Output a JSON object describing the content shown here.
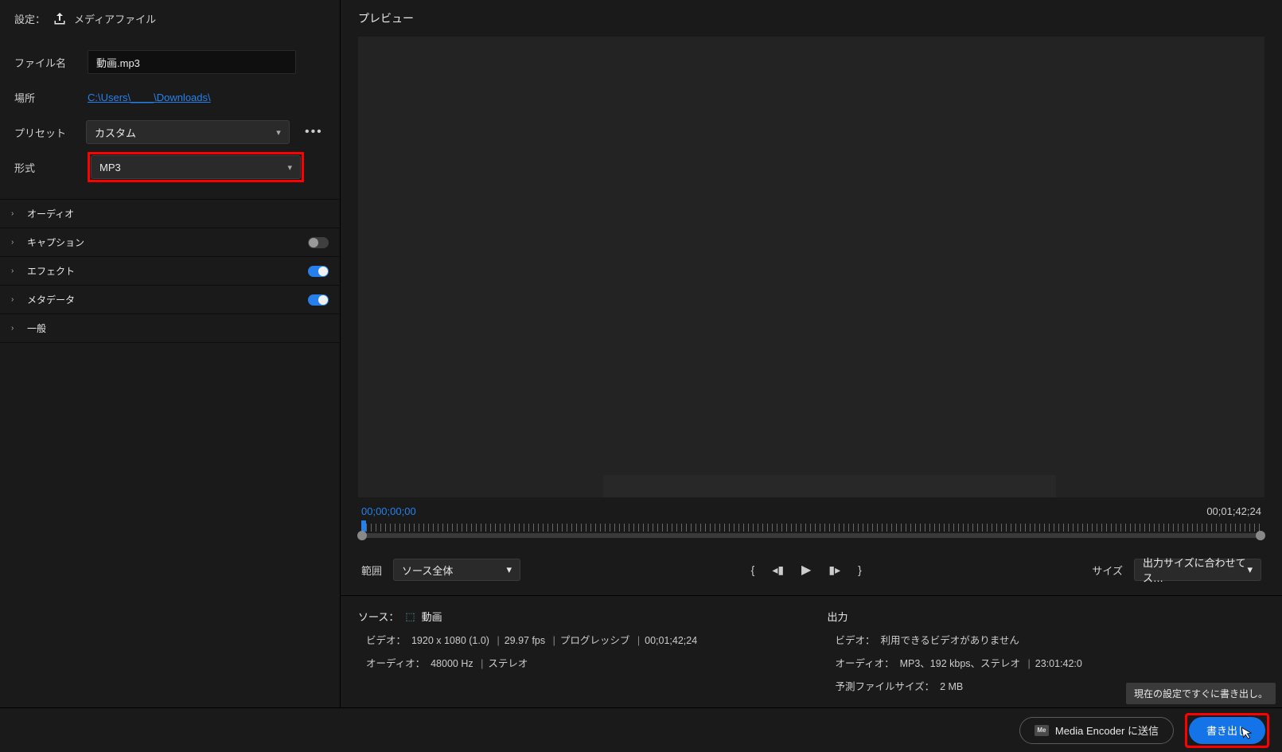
{
  "leftHeader": {
    "prefix": "設定：",
    "label": "メディアファイル"
  },
  "settings": {
    "fileNameLabel": "ファイル名",
    "fileName": "動画.mp3",
    "locationLabel": "場所",
    "locationPath": "C:\\Users\\____\\Downloads\\",
    "presetLabel": "プリセット",
    "presetValue": "カスタム",
    "formatLabel": "形式",
    "formatValue": "MP3"
  },
  "accordion": {
    "audio": "オーディオ",
    "caption": "キャプション",
    "effects": "エフェクト",
    "metadata": "メタデータ",
    "general": "一般"
  },
  "preview": {
    "header": "プレビュー",
    "tcStart": "00;00;00;00",
    "tcEnd": "00;01;42;24",
    "rangeLabel": "範囲",
    "rangeValue": "ソース全体",
    "sizeLabel": "サイズ",
    "sizeValue": "出力サイズに合わせてス…"
  },
  "source": {
    "title": "ソース：",
    "seqName": "動画",
    "videoLabel": "ビデオ：",
    "videoValue": "1920 x 1080 (1.0)",
    "fps": "29.97 fps",
    "scan": "プログレッシブ",
    "dur": "00;01;42;24",
    "audioLabel": "オーディオ：",
    "audioValue": "48000 Hz",
    "channels": "ステレオ"
  },
  "output": {
    "title": "出力",
    "videoLabel": "ビデオ：",
    "videoValue": "利用できるビデオがありません",
    "audioLabel": "オーディオ：",
    "audioValue": "MP3、192 kbps、ステレオ",
    "audioDur": "23:01:42:0",
    "estLabel": "予測ファイルサイズ：",
    "estValue": "2 MB"
  },
  "footer": {
    "mediaEncoder": "Media Encoder に送信",
    "export": "書き出し",
    "tooltip": "現在の設定ですぐに書き出し。"
  }
}
